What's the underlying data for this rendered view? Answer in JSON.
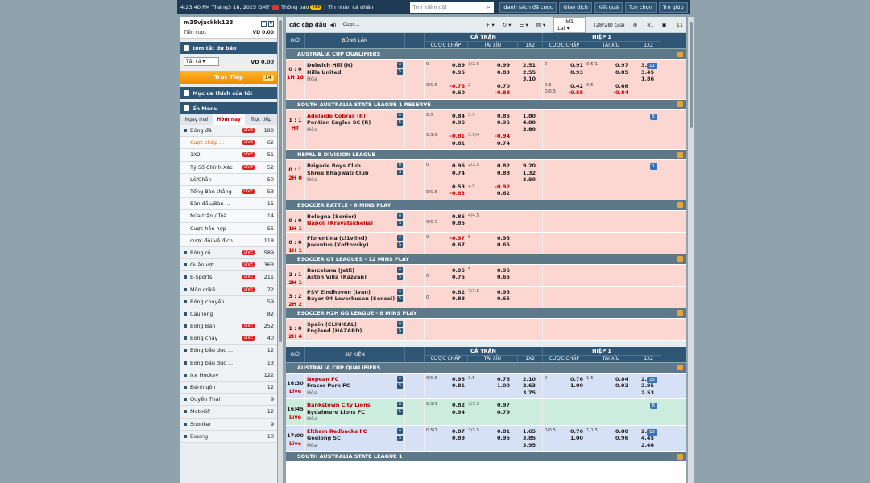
{
  "topbar": {
    "clock": "4:23:40 PM Tháng3 18, 2025 GMT +8",
    "notif_label": "Thông báo",
    "notif_count": "999",
    "messages": "Tin nhắn cá nhân",
    "search_placeholder": "Tìm kiếm đội",
    "buttons": [
      "danh sách đã cược",
      "Giao dịch",
      "Kết quả",
      "Tuỳ chọn",
      "Trợ giúp"
    ]
  },
  "user": {
    "name": "m35vjackkk123",
    "balance_label": "Tiền cược",
    "balance": "VD 0.00"
  },
  "summary": {
    "title": "tóm tắt dự báo",
    "filter": "Tất cả",
    "amount": "VD 0.00"
  },
  "live": {
    "label": "Trực Tiếp",
    "count": "14"
  },
  "favorite": "Mục ưa thích của tôi",
  "menu": {
    "title": "ẩn Menu",
    "tabs": [
      "Ngày mai",
      "Hôm nay",
      "Trực tiếp"
    ]
  },
  "sports": [
    {
      "name": "Bóng đá",
      "live": "LIVE",
      "num": "180",
      "type": "main"
    },
    {
      "name": "Cược chấp ...",
      "live": "LIVE",
      "num": "62",
      "type": "sub",
      "hl": true
    },
    {
      "name": "1X2",
      "live": "LIVE",
      "num": "51",
      "type": "sub"
    },
    {
      "name": "Tỷ Số Chính Xác",
      "live": "LIVE",
      "num": "52",
      "type": "sub"
    },
    {
      "name": "Lẻ/Chẵn",
      "live": "",
      "num": "50",
      "type": "sub"
    },
    {
      "name": "Tổng Bàn thắng",
      "live": "LIVE",
      "num": "53",
      "type": "sub"
    },
    {
      "name": "Bàn đầu/Bàn ...",
      "live": "",
      "num": "15",
      "type": "sub"
    },
    {
      "name": "Nửa trận / Toà...",
      "live": "",
      "num": "14",
      "type": "sub"
    },
    {
      "name": "Cược hỗn hợp",
      "live": "",
      "num": "55",
      "type": "sub"
    },
    {
      "name": "cược đội về đích",
      "live": "",
      "num": "118",
      "type": "sub"
    },
    {
      "name": "Bóng rổ",
      "live": "LIVE",
      "num": "589",
      "type": "main"
    },
    {
      "name": "Quần vợt",
      "live": "LIVE",
      "num": "363",
      "type": "main"
    },
    {
      "name": "E-Sports",
      "live": "LIVE",
      "num": "211",
      "type": "main"
    },
    {
      "name": "Môn crikê",
      "live": "LIVE",
      "num": "72",
      "type": "main"
    },
    {
      "name": "Bóng chuyền",
      "live": "",
      "num": "59",
      "type": "main"
    },
    {
      "name": "Cầu lông",
      "live": "",
      "num": "82",
      "type": "main"
    },
    {
      "name": "Bóng Bàn",
      "live": "LIVE",
      "num": "252",
      "type": "main"
    },
    {
      "name": "Bóng chày",
      "live": "LIVE",
      "num": "40",
      "type": "main"
    },
    {
      "name": "Bóng bầu dục ...",
      "live": "",
      "num": "12",
      "type": "main"
    },
    {
      "name": "Bóng bầu dục ...",
      "live": "",
      "num": "13",
      "type": "main"
    },
    {
      "name": "Ice Hockey",
      "live": "",
      "num": "122",
      "type": "main"
    },
    {
      "name": "Đánh gôn",
      "live": "",
      "num": "12",
      "type": "main"
    },
    {
      "name": "Quyền Thái",
      "live": "",
      "num": "9",
      "type": "main"
    },
    {
      "name": "MotoGP",
      "live": "",
      "num": "12",
      "type": "main"
    },
    {
      "name": "Snooker",
      "live": "",
      "num": "9",
      "type": "main"
    },
    {
      "name": "Boxing",
      "live": "",
      "num": "10",
      "type": "main"
    }
  ],
  "main": {
    "title": "các cập đấu",
    "update": "Cược...",
    "market": "Mã Lai",
    "count": "(28/28) Giải",
    "stat1": "81",
    "stat2": "11"
  },
  "live_header": {
    "time": "GIỜ",
    "team": "BÓNG LĂN",
    "full": "CẢ TRẬN",
    "half": "HIỆP 1",
    "cols": [
      "CƯỢC CHẤP",
      "TÀI XỈU",
      "1X2"
    ]
  },
  "upcoming_header": {
    "time": "GIỜ",
    "team": "SỰ KIỆN",
    "full": "CẢ TRẬN",
    "half": "HIỆP 1",
    "cols": [
      "CƯỢC CHẤP",
      "TÀI XỈU",
      "1X2"
    ]
  },
  "live_leagues": [
    {
      "name": "AUSTRALIA CUP QUALIFIERS",
      "matches": [
        {
          "color": "pink",
          "score": "0 : 0",
          "ht": "1H 18",
          "home": "Dulwich Hill (N)",
          "away": "Hills United",
          "draw": "Hòa",
          "red": "none",
          "more": "11",
          "full": [
            [
              "0",
              "0.89",
              "3/2.5",
              "0.99",
              "2.51"
            ],
            [
              "",
              "0.95",
              "",
              "0.83",
              "2.55"
            ],
            [
              "",
              "",
              "",
              "",
              "3.10"
            ],
            [
              "0/0.5",
              "-0.76",
              "2",
              "0.70",
              ""
            ],
            [
              "",
              "0.60",
              "",
              "-0.88",
              ""
            ]
          ],
          "half": [
            [
              "0",
              "0.91",
              "0.5/1",
              "0.97",
              "3.40"
            ],
            [
              "",
              "0.93",
              "",
              "0.85",
              "3.45"
            ],
            [
              "",
              "",
              "",
              "",
              "1.86"
            ],
            [
              "0.5",
              "0.42",
              "0.5",
              "0.66",
              ""
            ],
            [
              "0/0.5",
              "-0.58",
              "",
              "-0.84",
              ""
            ]
          ]
        }
      ]
    },
    {
      "name": "SOUTH AUSTRALIA STATE LEAGUE 1 RESERVE",
      "matches": [
        {
          "color": "pink",
          "score": "1 : 1",
          "ht": "HT",
          "home": "Adelaide Cobras (R)",
          "away": "Pontian Eagles SC (R)",
          "draw": "Hòa",
          "red": "home",
          "more": "5",
          "full": [
            [
              "0.5",
              "0.84",
              "3.5",
              "0.85",
              "1.80"
            ],
            [
              "",
              "0.96",
              "",
              "0.95",
              "4.80"
            ],
            [
              "",
              "",
              "",
              "",
              "2.80"
            ],
            [
              "0.5/1",
              "-0.81",
              "3.5/4",
              "-0.94",
              ""
            ],
            [
              "",
              "0.61",
              "",
              "0.74",
              ""
            ]
          ],
          "half": []
        }
      ]
    },
    {
      "name": "NEPAL B DIVISION LEAGUE",
      "matches": [
        {
          "color": "pink",
          "score": "0 : 1",
          "ht": "2H 0",
          "home": "Brigade Boys Club",
          "away": "Shree Bhagwati Club",
          "draw": "Hòa",
          "red": "none",
          "more": "1",
          "full": [
            [
              "0",
              "0.96",
              "2/2.5",
              "0.82",
              "9.20"
            ],
            [
              "",
              "0.74",
              "",
              "0.88",
              "1.32"
            ],
            [
              "",
              "",
              "",
              "",
              "3.50"
            ],
            [
              "",
              "0.53",
              "2.5",
              "-0.92",
              ""
            ],
            [
              "0/0.5",
              "-0.83",
              "",
              "0.62",
              ""
            ]
          ],
          "half": []
        }
      ]
    },
    {
      "name": "ESOCCER BATTLE - 8 MINS PLAY",
      "matches": [
        {
          "color": "pink",
          "score": "0 : 0",
          "ht": "1H 1",
          "home": "Bologna (Senior)",
          "away": "Napoli (Kravatskhelia)",
          "draw": "",
          "red": "away",
          "more": "",
          "full": [
            [
              "",
              "0.85",
              "4/4.5",
              "",
              " "
            ],
            [
              "0/0.5",
              "0.85",
              "",
              "",
              ""
            ]
          ],
          "half": []
        },
        {
          "color": "pink",
          "score": "0 : 0",
          "ht": "1H 1",
          "home": "Fiorentina (cl1vlind)",
          "away": "Juventus (Koftovsky)",
          "draw": "",
          "red": "none",
          "more": "",
          "full": [
            [
              "0",
              "-0.97",
              "5",
              "0.95",
              ""
            ],
            [
              "",
              "0.67",
              "",
              "0.65",
              ""
            ]
          ],
          "half": []
        }
      ]
    },
    {
      "name": "ESOCCER GT LEAGUES - 12 MINS PLAY",
      "matches": [
        {
          "color": "pink",
          "score": "2 : 1",
          "ht": "2H 1",
          "home": "Barcelona (Jetli)",
          "away": "Aston Villa (Razvan)",
          "draw": "",
          "red": "none",
          "more": "",
          "full": [
            [
              "",
              "0.95",
              "5",
              "0.95",
              ""
            ],
            [
              "0",
              "0.75",
              "",
              "0.65",
              ""
            ]
          ],
          "half": []
        },
        {
          "color": "pink",
          "score": "3 : 2",
          "ht": "2H 2",
          "home": "PSV Eindhoven (Ivan)",
          "away": "Bayer 04 Leverkusen (Sensei)",
          "draw": "",
          "red": "none",
          "more": "",
          "full": [
            [
              "",
              "0.82",
              "7/7.5",
              "0.95",
              ""
            ],
            [
              "0",
              "0.88",
              "",
              "0.65",
              ""
            ]
          ],
          "half": []
        }
      ]
    },
    {
      "name": "ESOCCER H2H GG LEAGUE - 8 MINS PLAY",
      "matches": [
        {
          "color": "pink",
          "score": "1 : 0",
          "ht": "2H 4",
          "home": "Spain (CLINICAL)",
          "away": "England (HAZARD)",
          "draw": "",
          "red": "none",
          "more": "",
          "full": [],
          "half": []
        }
      ]
    }
  ],
  "upcoming_leagues": [
    {
      "name": "AUSTRALIA CUP QUALIFIERS",
      "matches": [
        {
          "color": "blue",
          "score": "16:30",
          "ht": "Live",
          "home": "Nepean FC",
          "away": "Fraser Park FC",
          "draw": "Hòa",
          "red": "home",
          "more": "15",
          "full": [
            [
              "0/0.5",
              "0.95",
              "3.5",
              "0.76",
              "2.10"
            ],
            [
              "",
              "0.81",
              "",
              "1.00",
              "2.63"
            ],
            [
              "",
              "",
              "",
              "",
              "3.75"
            ]
          ],
          "half": [
            [
              "0",
              "0.76",
              "1.5",
              "0.84",
              "2.59"
            ],
            [
              "",
              "1.00",
              "",
              "0.92",
              "2.95"
            ],
            [
              "",
              "",
              "",
              "",
              "2.53"
            ]
          ]
        },
        {
          "color": "green",
          "score": "16:45",
          "ht": "Live",
          "home": "Bankstown City Lions",
          "away": "Rydalmere Lions FC",
          "draw": "Hòa",
          "red": "home",
          "more": "8",
          "full": [
            [
              "0.5/1",
              "0.82",
              "3/3.5",
              "0.97",
              ""
            ],
            [
              "",
              "0.94",
              "",
              "0.79",
              ""
            ]
          ],
          "half": []
        },
        {
          "color": "blue",
          "score": "17:00",
          "ht": "Live",
          "home": "Eltham Redbacks FC",
          "away": "Geelong SC",
          "draw": "Hòa",
          "red": "home",
          "more": "15",
          "full": [
            [
              "0.5/1",
              "0.87",
              "3/3.5",
              "0.81",
              "1.65"
            ],
            [
              "",
              "0.89",
              "",
              "0.95",
              "3.85"
            ],
            [
              "",
              "",
              "",
              "",
              "3.95"
            ]
          ],
          "half": [
            [
              "0/0.5",
              "0.76",
              "1/1.5",
              "0.80",
              "2.05"
            ],
            [
              "",
              "1.00",
              "",
              "0.96",
              "4.45"
            ],
            [
              "",
              "",
              "",
              "",
              "2.46"
            ]
          ]
        }
      ]
    },
    {
      "name": "SOUTH AUSTRALIA STATE LEAGUE 1",
      "matches": []
    }
  ]
}
